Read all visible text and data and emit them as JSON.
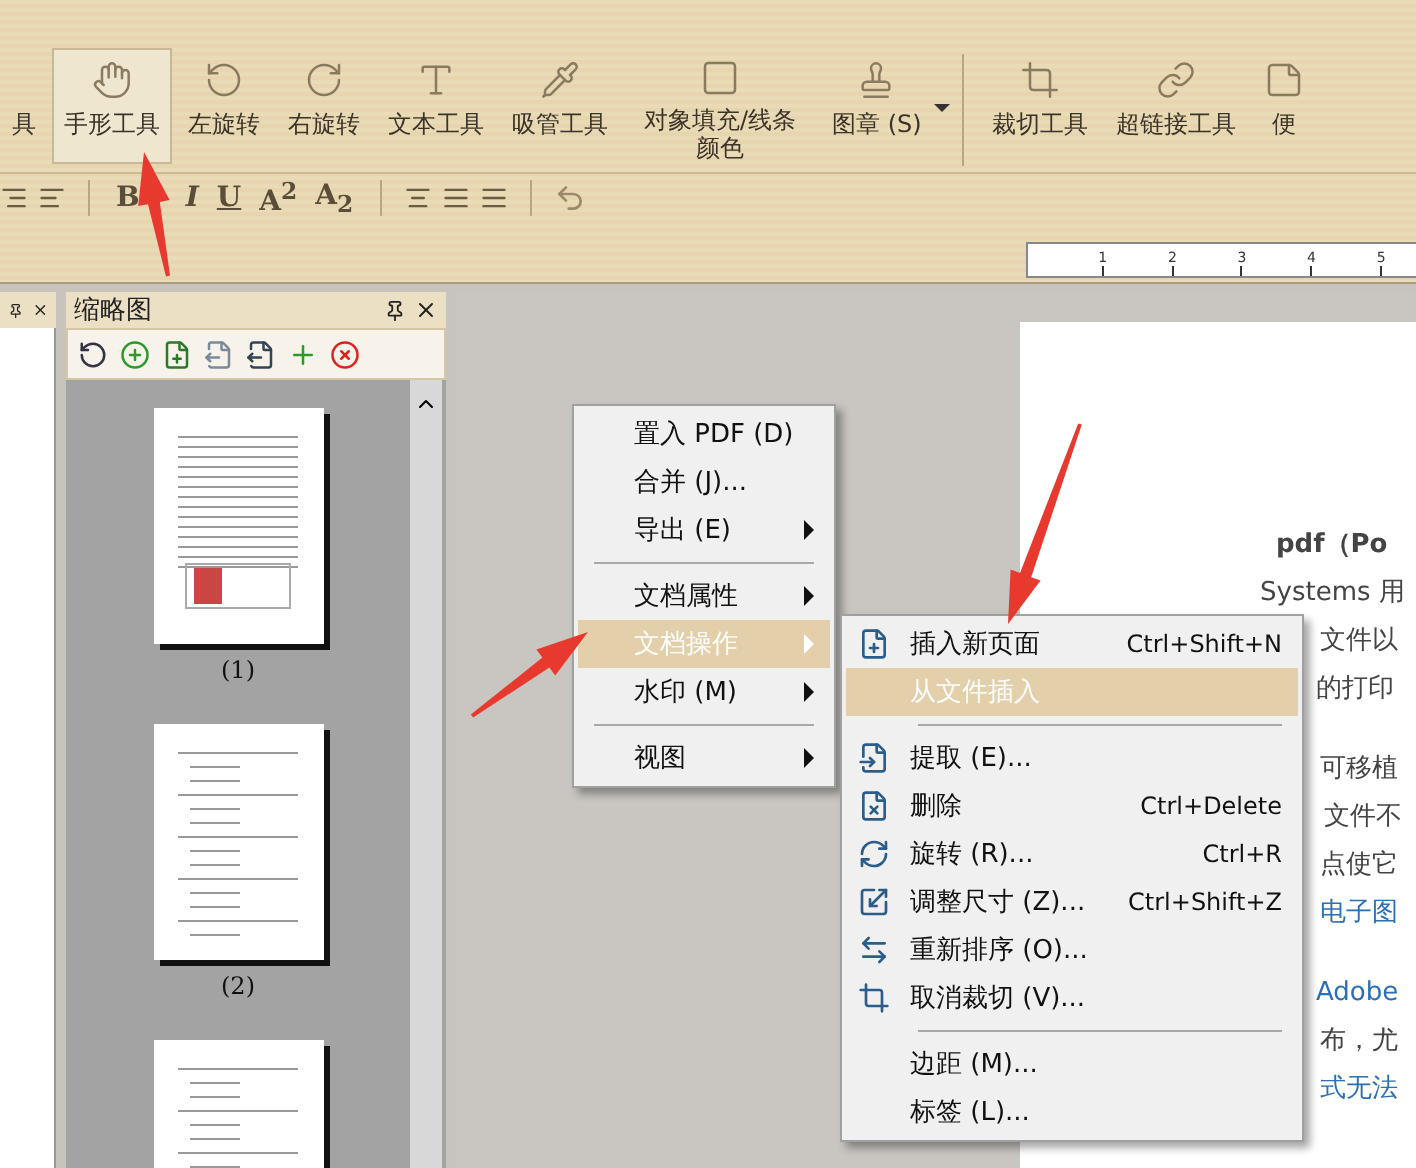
{
  "toolbar": {
    "tools": [
      {
        "label": "具",
        "selected": false,
        "kind": "tool"
      },
      {
        "label": "手形工具",
        "selected": true,
        "kind": "tool"
      },
      {
        "label": "左旋转",
        "selected": false,
        "kind": "tool"
      },
      {
        "label": "右旋转",
        "selected": false,
        "kind": "tool"
      },
      {
        "label": "文本工具",
        "selected": false,
        "kind": "tool"
      },
      {
        "label": "吸管工具",
        "selected": false,
        "kind": "tool"
      },
      {
        "label": "对象填充/线条颜色",
        "selected": false,
        "kind": "tool"
      },
      {
        "label": "图章 (S)",
        "selected": false,
        "kind": "dropdown"
      },
      {
        "label": "裁切工具",
        "selected": false,
        "kind": "tool"
      },
      {
        "label": "超链接工具",
        "selected": false,
        "kind": "tool"
      },
      {
        "label": "便",
        "selected": false,
        "kind": "tool"
      }
    ]
  },
  "format_bar": {
    "text_buttons": [
      "B",
      "I",
      "U",
      "A$^{2}$",
      "A$_{2}$"
    ]
  },
  "ruler": {
    "labels": [
      "1",
      "2",
      "3",
      "4",
      "5"
    ]
  },
  "thumbnail_panel": {
    "title": "缩略图",
    "pages": [
      "(1)",
      "(2)"
    ]
  },
  "document": {
    "lines": [
      {
        "text": "pdf（Po",
        "kind": "title"
      },
      {
        "text": "Systems 用",
        "kind": "text"
      },
      {
        "text": "文件以",
        "kind": "text"
      },
      {
        "text": "的打印",
        "kind": "text"
      },
      {
        "text": "可移植",
        "kind": "text"
      },
      {
        "text": "文件不",
        "kind": "text"
      },
      {
        "text": "点使它",
        "kind": "text"
      },
      {
        "text": "电子图",
        "kind": "link"
      },
      {
        "text": "Adobe",
        "kind": "link"
      },
      {
        "text": "布，尤",
        "kind": "text"
      },
      {
        "text": "式无法",
        "kind": "link"
      }
    ]
  },
  "context_menu": {
    "items": [
      {
        "kind": "item",
        "label": "置入 PDF (D)",
        "submenu": false,
        "selected": false
      },
      {
        "kind": "item",
        "label": "合并 (J)...",
        "submenu": false,
        "selected": false
      },
      {
        "kind": "item",
        "label": "导出 (E)",
        "submenu": true,
        "selected": false
      },
      {
        "kind": "separator"
      },
      {
        "kind": "item",
        "label": "文档属性",
        "submenu": true,
        "selected": false
      },
      {
        "kind": "item",
        "label": "文档操作",
        "submenu": true,
        "selected": true
      },
      {
        "kind": "item",
        "label": "水印 (M)",
        "submenu": true,
        "selected": false
      },
      {
        "kind": "separator"
      },
      {
        "kind": "item",
        "label": "视图",
        "submenu": true,
        "selected": false
      }
    ]
  },
  "submenu": {
    "items": [
      {
        "kind": "item",
        "label": "插入新页面",
        "shortcut": "Ctrl+Shift+N",
        "selected": false
      },
      {
        "kind": "item",
        "label": "从文件插入",
        "selected": true
      },
      {
        "kind": "separator"
      },
      {
        "kind": "item",
        "label": "提取 (E)...",
        "selected": false
      },
      {
        "kind": "item",
        "label": "删除",
        "shortcut": "Ctrl+Delete",
        "selected": false
      },
      {
        "kind": "item",
        "label": "旋转 (R)...",
        "shortcut": "Ctrl+R",
        "selected": false
      },
      {
        "kind": "item",
        "label": "调整尺寸 (Z)...",
        "shortcut": "Ctrl+Shift+Z",
        "selected": false
      },
      {
        "kind": "item",
        "label": "重新排序 (O)...",
        "selected": false
      },
      {
        "kind": "item",
        "label": "取消裁切 (V)...",
        "selected": false
      },
      {
        "kind": "separator"
      },
      {
        "kind": "item",
        "label": "边距 (M)...",
        "selected": false
      },
      {
        "kind": "item",
        "label": "标签 (L)...",
        "selected": false
      }
    ]
  }
}
